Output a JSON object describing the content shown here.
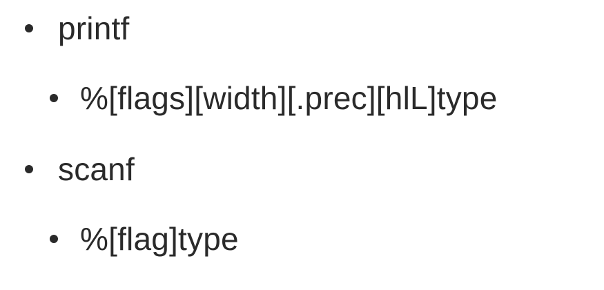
{
  "slide": {
    "items": [
      {
        "level": 1,
        "text": "printf"
      },
      {
        "level": 2,
        "text": "%[flags][width][.prec][hlL]type"
      },
      {
        "level": 1,
        "text": "scanf"
      },
      {
        "level": 2,
        "text": "%[flag]type"
      }
    ]
  },
  "colors": {
    "background": "#ffffff",
    "text": "#2a2a2a"
  }
}
